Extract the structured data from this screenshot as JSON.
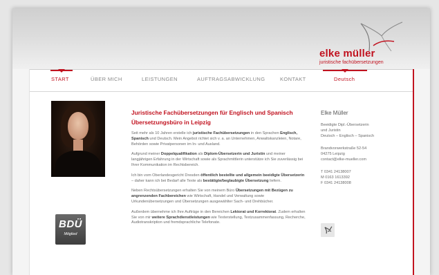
{
  "brand": {
    "name": "elke müller",
    "tagline": "juristische fachübersetzungen",
    "accent": "#c1121f"
  },
  "nav": {
    "items": [
      {
        "label": "START",
        "active": true
      },
      {
        "label": "ÜBER MICH",
        "active": false
      },
      {
        "label": "LEISTUNGEN",
        "active": false
      },
      {
        "label": "AUFTRAGSABWICKLUNG",
        "active": false
      },
      {
        "label": "KONTAKT",
        "active": false
      },
      {
        "label": "Deutsch",
        "active": true
      }
    ]
  },
  "badge": {
    "big": "BDÜ",
    "small": "Mitglied"
  },
  "content": {
    "heading": "Juristische Fachübersetzungen für Englisch und Spanisch Übersetzungsbüro in Leipzig",
    "p1_parts": [
      "Seit mehr als 10 Jahren erstelle ich ",
      "juristische Fachübersetzungen",
      " in den Sprachen ",
      "Englisch, Spanisch",
      " und Deutsch. Mein Angebot richtet sich v. a. an Unternehmen, Anwaltskanzleien, Notare, Behörden sowie Privatpersonen im In- und Ausland."
    ],
    "p2_parts": [
      "Aufgrund meiner ",
      "Doppelqualifikation",
      " als ",
      "Diplom-Übersetzerin und Juristin",
      " und meiner langjährigen Erfahrung in der Wirtschaft sowie als Sprachmittlerin unterstütze ich Sie zuverlässig bei Ihrer Kommunikation im Rechtsbereich."
    ],
    "p3_parts": [
      "Ich bin vom Oberlandesgericht Dresden ",
      "öffentlich bestellte und allgemein beeidigte Übersetzerin",
      " – daher kann ich bei Bedarf alle Texte als ",
      "bestätigte/beglaubigte Übersetzung",
      " liefern."
    ],
    "p4_parts": [
      "Neben Rechtsübersetzungen erhalten Sie von meinem Büro ",
      "Übersetzungen mit Bezügen zu angrenzenden Fachbereichen",
      " wie Wirtschaft, Handel und Verwaltung sowie Urkundenübersetzungen und Übersetzungen ausgewählter Sach- und Drehbücher."
    ],
    "p5_parts": [
      "Außerdem übernehme ich Ihre Aufträge in den Bereichen ",
      "Lektorat und Korrektorat",
      ". Zudem erhalten Sie von mir ",
      "weitere Sprachdienstleistungen",
      " wie Texterstellung, Textzusammenfassung, Recherche, Audiotranskription und fremdsprachliche Telefonate."
    ]
  },
  "sidebar": {
    "name": "Elke Müller",
    "title_lines": [
      "Beeidigte Dipl.-Übersetzerin",
      "und Juristin",
      "Deutsch – Englisch – Spanisch"
    ],
    "address_lines": [
      "Brandvorwerkstraße 52-54",
      "04275 Leipzig",
      "contact@elke-mueller.com"
    ],
    "phone_lines": [
      "T 0341 24138007",
      "M 0163 1613392",
      "F 0341 24138008"
    ]
  },
  "icons": {
    "logo_swoosh": "swoosh-icon",
    "sidebar_logo": "swoosh-small-icon"
  }
}
